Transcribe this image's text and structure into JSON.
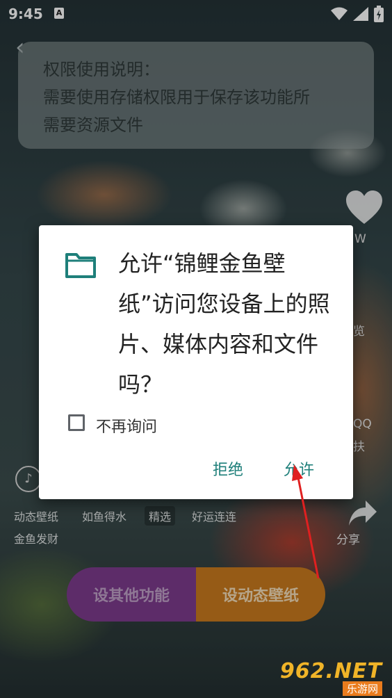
{
  "status_bar": {
    "time": "9:45",
    "notification_badge": "A"
  },
  "permission_banner": {
    "line1": "权限使用说明：",
    "line2": "需要使用存储权限用于保存该功能所",
    "line3": "需要资源文件"
  },
  "side_actions": {
    "wallpaper_partial": "W",
    "preview_partial": "览",
    "qq_partial": "QQ",
    "qq_sub_partial": "扶",
    "share_label": "分享"
  },
  "bottom": {
    "label_dynamic": "动态壁纸",
    "label_ruyu": "如鱼得水",
    "label_jingxuan": "精选",
    "label_haoyun": "好运连连",
    "label_goldfish": "金鱼发财",
    "btn_other": "设其他功能",
    "btn_dynamic": "设动态壁纸"
  },
  "dialog": {
    "title": "允许“锦鲤金鱼壁纸”访问您设备上的照片、媒体内容和文件吗？",
    "checkbox_label": "不再询问",
    "deny_label": "拒绝",
    "allow_label": "允许"
  },
  "watermark": {
    "main": "962.NET",
    "sub": "乐游网"
  },
  "colors": {
    "accent": "#1e7f7a",
    "purple_btn": "#7c3b8d",
    "orange_btn": "#c97a1e",
    "arrow": "#e02020"
  },
  "icons": [
    "folder-icon",
    "heart-icon",
    "music-icon",
    "share-icon",
    "wifi-icon",
    "signal-icon",
    "battery-icon",
    "back-chevron-icon"
  ]
}
